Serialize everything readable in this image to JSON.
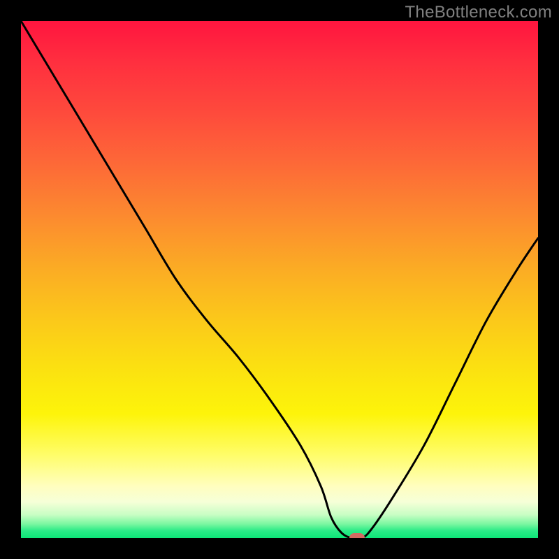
{
  "watermark": "TheBottleneck.com",
  "colors": {
    "background": "#000000",
    "watermark": "#808080",
    "curve": "#000000",
    "marker": "#d36a62",
    "gradient_top": "#ff153f",
    "gradient_bottom": "#0de578"
  },
  "chart_data": {
    "type": "line",
    "title": "",
    "xlabel": "",
    "ylabel": "",
    "xlim": [
      0,
      100
    ],
    "ylim": [
      0,
      100
    ],
    "series": [
      {
        "name": "bottleneck-curve",
        "x": [
          0,
          6,
          12,
          18,
          24,
          30,
          36,
          42,
          48,
          54,
          58,
          60,
          62,
          64,
          66,
          68,
          72,
          78,
          84,
          90,
          96,
          100
        ],
        "values": [
          100,
          90,
          80,
          70,
          60,
          50,
          42,
          35,
          27,
          18,
          10,
          4,
          1,
          0,
          0,
          2,
          8,
          18,
          30,
          42,
          52,
          58
        ]
      }
    ],
    "marker": {
      "x": 65,
      "y": 0
    },
    "annotations": []
  }
}
